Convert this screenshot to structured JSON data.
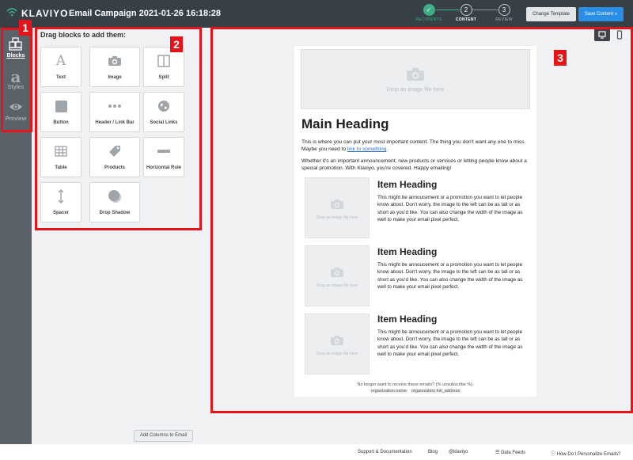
{
  "app": {
    "brand": "KLAVIYO",
    "campaign_title": "Email Campaign 2021-01-26 16:18:28"
  },
  "steps": [
    {
      "num": "✓",
      "label": "RECIPIENTS"
    },
    {
      "num": "2",
      "label": "CONTENT"
    },
    {
      "num": "3",
      "label": "REVIEW"
    }
  ],
  "header_buttons": {
    "change_template": "Change Template",
    "save_content": "Save Content »"
  },
  "leftnav": [
    {
      "label": "Blocks",
      "icon": "blocks-icon"
    },
    {
      "label": "Styles",
      "icon": "styles-icon"
    },
    {
      "label": "Preview",
      "icon": "eye-icon"
    }
  ],
  "panel": {
    "title": "Drag blocks to add them:",
    "blocks": [
      {
        "label": "Text",
        "icon": "text-icon"
      },
      {
        "label": "Image",
        "icon": "camera-icon"
      },
      {
        "label": "Split",
        "icon": "split-icon"
      },
      {
        "label": "Button",
        "icon": "button-icon"
      },
      {
        "label": "Header / Link Bar",
        "icon": "link-bar-icon"
      },
      {
        "label": "Social Links",
        "icon": "globe-icon"
      },
      {
        "label": "Table",
        "icon": "table-icon"
      },
      {
        "label": "Products",
        "icon": "tag-icon"
      },
      {
        "label": "Horizontal Rule",
        "icon": "horizontal-rule-icon"
      },
      {
        "label": "Spacer",
        "icon": "spacer-icon"
      },
      {
        "label": "Drop Shadow",
        "icon": "drop-shadow-icon"
      }
    ],
    "add_columns": "Add Columns to Email"
  },
  "email": {
    "hero_drop": "Drop an image file here",
    "main_heading": "Main Heading",
    "para1_before": "This is where you can put your most important content. The thing you don't want any one to miss. Maybe you need to ",
    "para1_link": "link to something",
    "para1_after": ".",
    "para2": "Whether it's an important announcement, new products or services or letting people know about a special promotion. With Klaviyo, you're covered. Happy emailing!",
    "items": [
      {
        "heading": "Item Heading",
        "drop": "Drop an image file here",
        "text": "This might be annoucement or a promotion you want to let people know about. Don't worry, the image to the left can be as tall or as short as you'd like. You can also change the width of the image as well to make your email pixel perfect."
      },
      {
        "heading": "Item Heading",
        "drop": "Drop an image file here",
        "text": "This might be annoucement or a promotion you want to let people know about. Don't worry, the image to the left can be as tall or as short as you'd like. You can also change the width of the image as well to make your email pixel perfect."
      },
      {
        "heading": "Item Heading",
        "drop": "Drop an image file here",
        "text": "This might be annoucement or a promotion you want to let people know about. Don't worry, the image to the left can be as tall or as short as you'd like. You can also change the width of the image as well to make your email pixel perfect."
      }
    ],
    "unsubscribe": "No longer want to receive these emails? {% unsubscribe %}.",
    "org_name": "organization.name",
    "org_address": "organization.full_address"
  },
  "footer": {
    "support": "Support & Documentation",
    "blog": "Blog",
    "twitter": "@klaviyo",
    "data_feeds": "Data Feeds",
    "personalize": "How Do I Personalize Emails?"
  },
  "annotations": [
    "1",
    "2",
    "3"
  ],
  "colors": {
    "topbar": "#373f47",
    "accent_green": "#3dae84",
    "save_blue": "#2b8ee6",
    "annotation_red": "#e8121b",
    "leftnav": "#5a6168"
  }
}
